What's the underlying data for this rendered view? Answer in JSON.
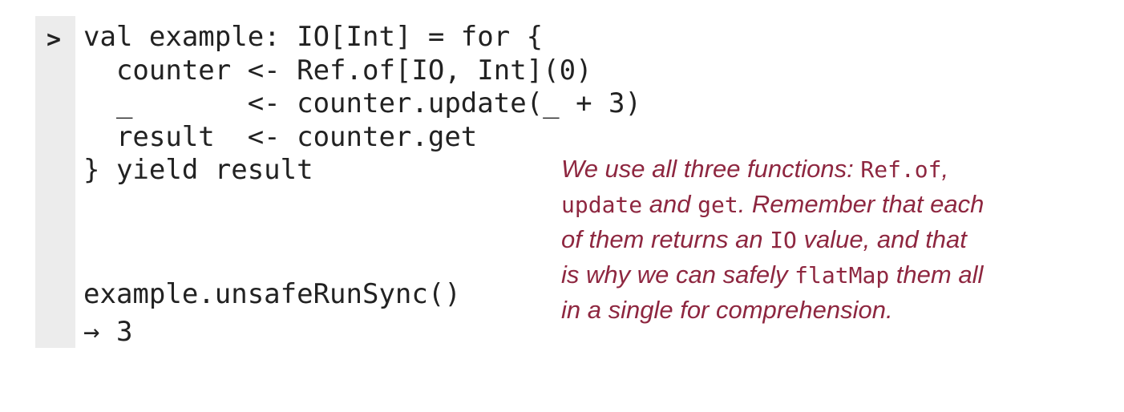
{
  "prompt": ">",
  "code_lines": [
    "val example: IO[Int] = for {",
    "  counter <- Ref.of[IO, Int](0)",
    "  _       <- counter.update(_ + 3)",
    "  result  <- counter.get",
    "} yield result"
  ],
  "output_lines": [
    "example.unsafeRunSync()",
    "→ 3"
  ],
  "annotation": {
    "l1_a": "We use all three functions: ",
    "l1_code": "Ref.of",
    "l1_b": ",",
    "l2_code1": "update",
    "l2_a": " and ",
    "l2_code2": "get",
    "l2_b": ". Remember that each",
    "l3_a": "of them returns an ",
    "l3_code": "IO",
    "l3_b": " value, and that",
    "l4_a": "is why we can safely ",
    "l4_code": "flatMap",
    "l4_b": " them all",
    "l5": "in a single for comprehension."
  },
  "colors": {
    "code_text": "#222222",
    "annotation_text": "#8e2740",
    "gutter": "#ececec"
  }
}
